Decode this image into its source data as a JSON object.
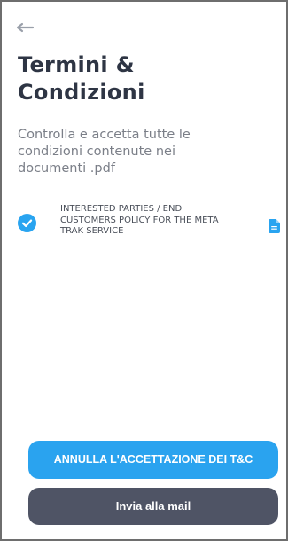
{
  "header": {
    "back_icon": "arrow-left-icon"
  },
  "page": {
    "title": "Termini & Condizioni",
    "subtitle": "Controlla e accetta tutte le condizioni contenute nei documenti .pdf"
  },
  "documents": [
    {
      "label": "INTERESTED PARTIES / END CUSTOMERS POLICY FOR THE META TRAK SERVICE",
      "checked": true,
      "status_icon": "check-circle-icon",
      "file_icon": "document-icon"
    }
  ],
  "actions": {
    "cancel_acceptance_label": "ANNULLA L'ACCETTAZIONE DEI T&C",
    "send_mail_label": "Invia alla mail"
  },
  "colors": {
    "accent": "#2aa3ef",
    "secondary_button": "#4f5465",
    "title": "#2e3544",
    "subtitle": "#7b7f88"
  }
}
